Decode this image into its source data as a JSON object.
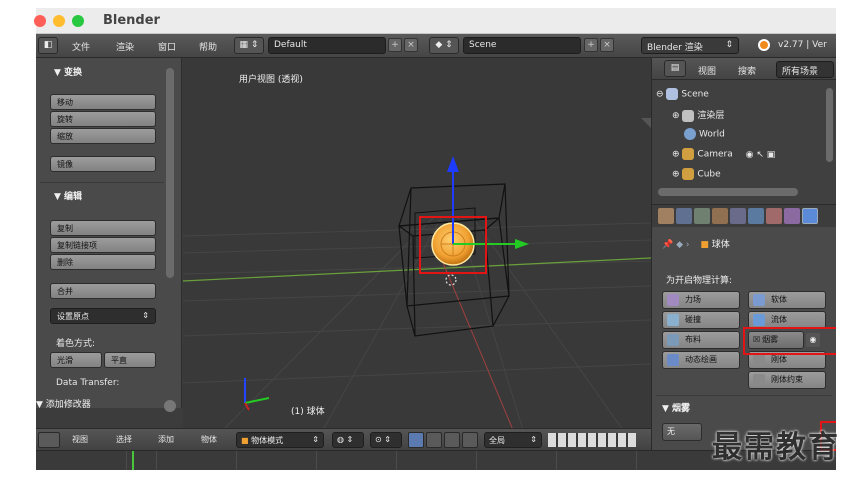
{
  "app": {
    "title": "Blender"
  },
  "menubar": {
    "menus": [
      "文件",
      "渲染",
      "窗口",
      "帮助"
    ],
    "layout": "Default",
    "scene": "Scene",
    "render_engine": "Blender 渲染",
    "version": "v2.77 | Ver"
  },
  "toolshelf": {
    "transform_header": "▼ 变换",
    "transform_buttons": [
      "移动",
      "旋转",
      "缩放"
    ],
    "mirror": "镜像",
    "edit_header": "▼ 编辑",
    "edit_buttons": [
      "复制",
      "复制链接项",
      "删除"
    ],
    "join": "合并",
    "set_origin": "设置原点",
    "shading_label": "着色方式:",
    "smooth": "光滑",
    "flat": "平直",
    "data_transfer": "Data Transfer:",
    "add_modifier": "▼ 添加修改器"
  },
  "viewport": {
    "title": "用户视图 (透视)",
    "object_label": "(1) 球体"
  },
  "viewport_header": {
    "menus": [
      "视图",
      "选择",
      "添加",
      "物体"
    ],
    "mode": "物体模式",
    "global": "全局"
  },
  "outliner": {
    "header": [
      "视图",
      "搜索",
      "所有场景"
    ],
    "rows": [
      "Scene",
      "渲染层",
      "World",
      "Camera",
      "Cube"
    ]
  },
  "properties": {
    "breadcrumb_object": "球体",
    "physics_label": "为开启物理计算:",
    "buttons": [
      "力场",
      "软体",
      "碰撞",
      "流体",
      "布料",
      "烟雾",
      "动态绘画",
      "刚体",
      "刚体约束"
    ],
    "smoke_header": "▼ 烟雾",
    "none_button": "无"
  },
  "watermark": "最需教育",
  "colors": {
    "highlight_red": "#e21414",
    "sphere_orange": "#f0a030",
    "axis_blue": "#1e3cff",
    "axis_green": "#22cc22",
    "axis_red": "#cc2222"
  }
}
